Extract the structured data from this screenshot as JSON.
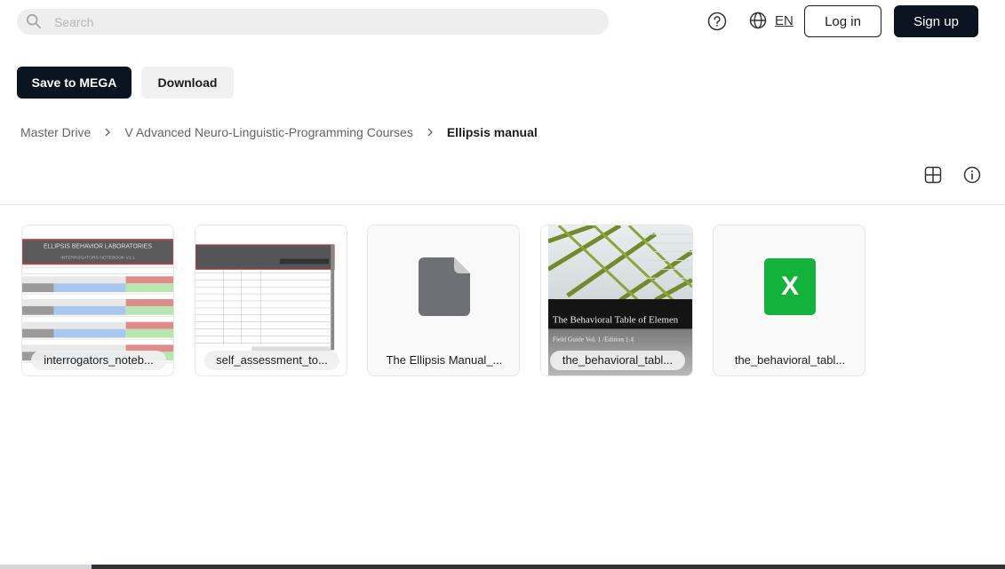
{
  "header": {
    "search_placeholder": "Search",
    "language": "EN",
    "login_label": "Log in",
    "signup_label": "Sign up"
  },
  "actions": {
    "save_label": "Save to MEGA",
    "download_label": "Download"
  },
  "breadcrumb": {
    "items": [
      "Master Drive",
      "V Advanced Neuro-Linguistic-Programming Courses"
    ],
    "current": "Ellipsis manual"
  },
  "files": [
    {
      "name": "interrogators_noteb...",
      "type": "spreadsheet-image"
    },
    {
      "name": "self_assessment_to...",
      "type": "document-image"
    },
    {
      "name": "The Ellipsis Manual_...",
      "type": "generic-file"
    },
    {
      "name": "the_behavioral_tabl...",
      "type": "cover-image",
      "cover_title": "The Behavioral Table of Elemen",
      "cover_subtitle": "Field Guide   Vol. 1 /Edition 1.4"
    },
    {
      "name": "the_behavioral_tabl...",
      "type": "excel",
      "excel_glyph": "X"
    }
  ],
  "thumb1": {
    "title": "ELLIPSIS BEHAVIOR LABORATORIES",
    "subtitle": "INTERROGATORS NOTEBOOK V1.1"
  },
  "colors": {
    "primary_dark": "#0a1320",
    "excel_green": "#12b23b",
    "generic_file": "#6e7075"
  }
}
